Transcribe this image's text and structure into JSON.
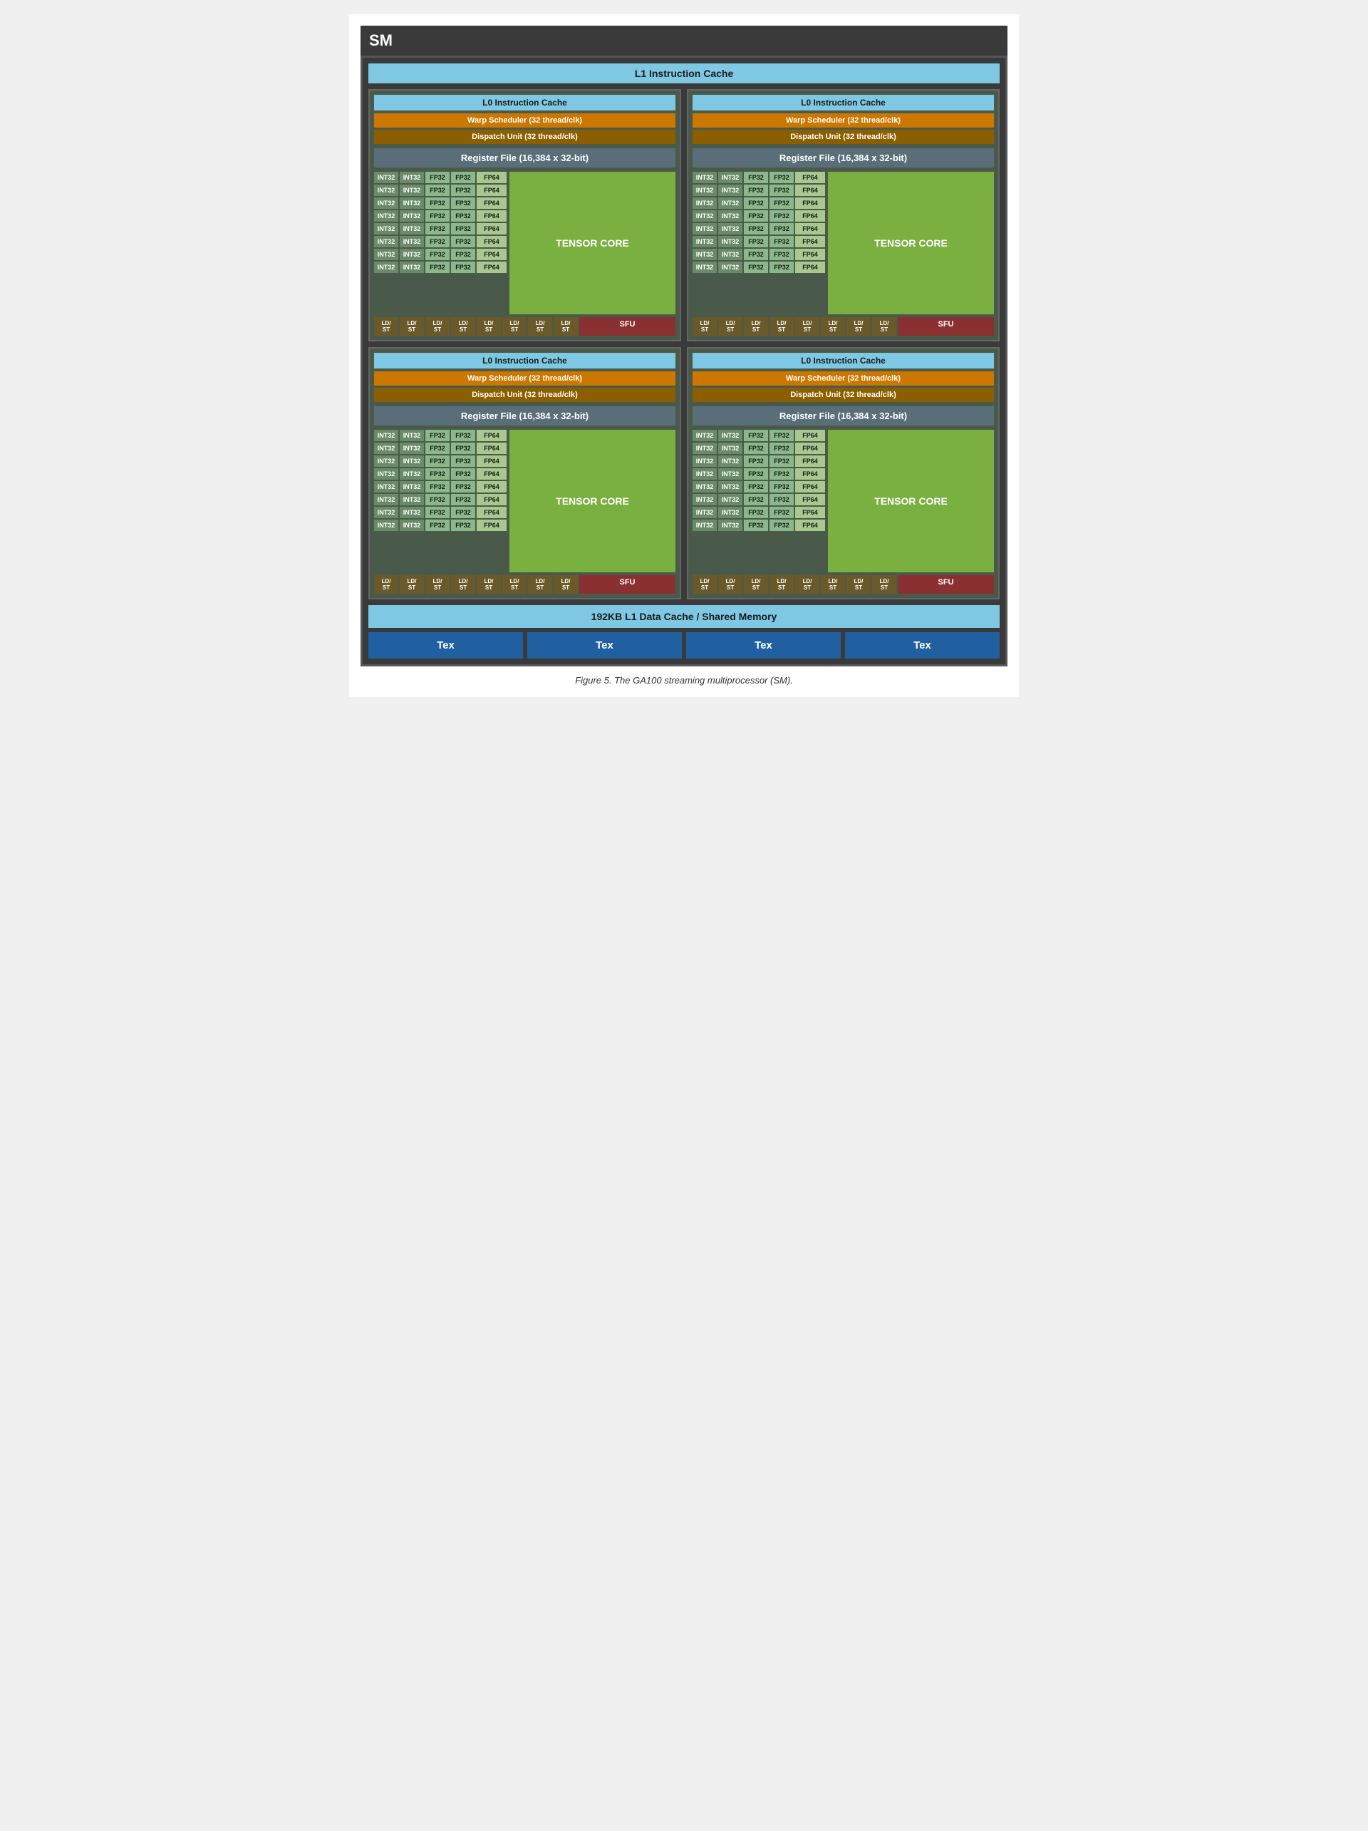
{
  "title": "SM",
  "l1_instruction_cache": "L1 Instruction Cache",
  "l1_data_cache": "192KB L1 Data Cache / Shared Memory",
  "figure_caption": "Figure 5. The GA100 streaming multiprocessor (SM).",
  "quadrants": [
    {
      "id": "q1",
      "l0_cache": "L0 Instruction Cache",
      "warp_scheduler": "Warp Scheduler (32 thread/clk)",
      "dispatch_unit": "Dispatch Unit (32 thread/clk)",
      "register_file": "Register File (16,384 x 32-bit)",
      "tensor_core": "TENSOR CORE"
    },
    {
      "id": "q2",
      "l0_cache": "L0 Instruction Cache",
      "warp_scheduler": "Warp Scheduler (32 thread/clk)",
      "dispatch_unit": "Dispatch Unit (32 thread/clk)",
      "register_file": "Register File (16,384 x 32-bit)",
      "tensor_core": "TENSOR CORE"
    },
    {
      "id": "q3",
      "l0_cache": "L0 Instruction Cache",
      "warp_scheduler": "Warp Scheduler (32 thread/clk)",
      "dispatch_unit": "Dispatch Unit (32 thread/clk)",
      "register_file": "Register File (16,384 x 32-bit)",
      "tensor_core": "TENSOR CORE"
    },
    {
      "id": "q4",
      "l0_cache": "L0 Instruction Cache",
      "warp_scheduler": "Warp Scheduler (32 thread/clk)",
      "dispatch_unit": "Dispatch Unit (32 thread/clk)",
      "register_file": "Register File (16,384 x 32-bit)",
      "tensor_core": "TENSOR CORE"
    }
  ],
  "tex_units": [
    "Tex",
    "Tex",
    "Tex",
    "Tex"
  ],
  "cuda_rows": [
    [
      "INT32",
      "INT32",
      "FP32",
      "FP32",
      "FP64"
    ],
    [
      "INT32",
      "INT32",
      "FP32",
      "FP32",
      "FP64"
    ],
    [
      "INT32",
      "INT32",
      "FP32",
      "FP32",
      "FP64"
    ],
    [
      "INT32",
      "INT32",
      "FP32",
      "FP32",
      "FP64"
    ],
    [
      "INT32",
      "INT32",
      "FP32",
      "FP32",
      "FP64"
    ],
    [
      "INT32",
      "INT32",
      "FP32",
      "FP32",
      "FP64"
    ],
    [
      "INT32",
      "INT32",
      "FP32",
      "FP32",
      "FP64"
    ],
    [
      "INT32",
      "INT32",
      "FP32",
      "FP32",
      "FP64"
    ]
  ],
  "ld_st_units": [
    "LD/\nST",
    "LD/\nST",
    "LD/\nST",
    "LD/\nST",
    "LD/\nST",
    "LD/\nST",
    "LD/\nST",
    "LD/\nST"
  ],
  "sfu_label": "SFU"
}
